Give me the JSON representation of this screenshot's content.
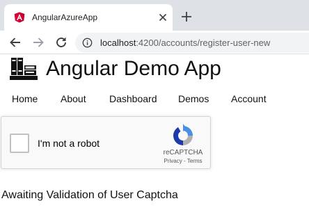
{
  "browser": {
    "tab": {
      "title": "AngularAzureApp"
    },
    "new_tab_symbol": "+",
    "address": {
      "host": "localhost",
      "path": ":4200/accounts/register-user-new"
    },
    "colors": {
      "tabstrip": "#dee1e6",
      "omnibox": "#f1f3f4",
      "favicon": "#dd0031"
    },
    "icons": [
      "angular-favicon-icon",
      "close-icon",
      "plus-icon",
      "back-arrow-icon",
      "forward-arrow-icon",
      "reload-icon",
      "info-icon"
    ]
  },
  "app": {
    "title": "Angular Demo App",
    "logo_icon": "books-icon"
  },
  "nav": {
    "items": [
      {
        "label": "Home"
      },
      {
        "label": "About"
      },
      {
        "label": "Dashboard"
      },
      {
        "label": "Demos"
      },
      {
        "label": "Account"
      }
    ]
  },
  "recaptcha": {
    "label": "I'm not a robot",
    "brand": "reCAPTCHA",
    "privacy": "Privacy",
    "separator": " - ",
    "terms": "Terms",
    "checked": false,
    "colors": {
      "blue": "#1c3aa9",
      "light_blue": "#4a90e2",
      "gray": "#b0b0b0"
    }
  },
  "status": {
    "message": "Awaiting Validation of User Captcha"
  }
}
